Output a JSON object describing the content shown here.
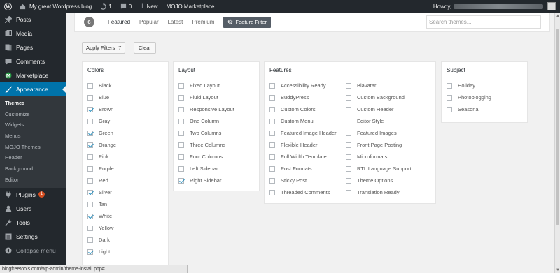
{
  "adminbar": {
    "site_name": "My great Wordpress blog",
    "updates_count": "1",
    "comments_count": "0",
    "new_label": "New",
    "mojo_label": "MOJO Marketplace",
    "howdy": "Howdy,"
  },
  "sidebar": {
    "items": [
      {
        "label": "Posts",
        "icon": "pushpin-icon"
      },
      {
        "label": "Media",
        "icon": "media-icon"
      },
      {
        "label": "Pages",
        "icon": "pages-icon"
      },
      {
        "label": "Comments",
        "icon": "comment-icon"
      },
      {
        "label": "Marketplace",
        "icon": "marketplace-icon"
      },
      {
        "label": "Appearance",
        "icon": "paintbrush-icon"
      }
    ],
    "submenu": [
      "Themes",
      "Customize",
      "Widgets",
      "Menus",
      "MOJO Themes",
      "Header",
      "Background",
      "Editor"
    ],
    "lower_items": [
      {
        "label": "Plugins",
        "icon": "plugin-icon",
        "badge": "1"
      },
      {
        "label": "Users",
        "icon": "users-icon"
      },
      {
        "label": "Tools",
        "icon": "wrench-icon"
      },
      {
        "label": "Settings",
        "icon": "settings-icon"
      },
      {
        "label": "Collapse menu",
        "icon": "collapse-icon"
      }
    ]
  },
  "filterbar": {
    "count": "6",
    "tabs": [
      "Featured",
      "Popular",
      "Latest",
      "Premium"
    ],
    "feature_filter": "Feature Filter",
    "search_placeholder": "Search themes..."
  },
  "actions": {
    "apply_label": "Apply Filters",
    "apply_count": "7",
    "clear_label": "Clear"
  },
  "groups": {
    "colors": {
      "title": "Colors",
      "options": [
        {
          "label": "Black",
          "checked": false
        },
        {
          "label": "Blue",
          "checked": false
        },
        {
          "label": "Brown",
          "checked": true
        },
        {
          "label": "Gray",
          "checked": false
        },
        {
          "label": "Green",
          "checked": true
        },
        {
          "label": "Orange",
          "checked": true
        },
        {
          "label": "Pink",
          "checked": false
        },
        {
          "label": "Purple",
          "checked": false
        },
        {
          "label": "Red",
          "checked": false
        },
        {
          "label": "Silver",
          "checked": true
        },
        {
          "label": "Tan",
          "checked": false
        },
        {
          "label": "White",
          "checked": true
        },
        {
          "label": "Yellow",
          "checked": false
        },
        {
          "label": "Dark",
          "checked": false
        },
        {
          "label": "Light",
          "checked": true
        }
      ]
    },
    "layout": {
      "title": "Layout",
      "options": [
        {
          "label": "Fixed Layout",
          "checked": false
        },
        {
          "label": "Fluid Layout",
          "checked": false
        },
        {
          "label": "Responsive Layout",
          "checked": false
        },
        {
          "label": "One Column",
          "checked": false
        },
        {
          "label": "Two Columns",
          "checked": false
        },
        {
          "label": "Three Columns",
          "checked": false
        },
        {
          "label": "Four Columns",
          "checked": false
        },
        {
          "label": "Left Sidebar",
          "checked": false
        },
        {
          "label": "Right Sidebar",
          "checked": true
        }
      ]
    },
    "features": {
      "title": "Features",
      "col1": [
        {
          "label": "Accessibility Ready",
          "checked": false
        },
        {
          "label": "BuddyPress",
          "checked": false
        },
        {
          "label": "Custom Colors",
          "checked": false
        },
        {
          "label": "Custom Menu",
          "checked": false
        },
        {
          "label": "Featured Image Header",
          "checked": false
        },
        {
          "label": "Flexible Header",
          "checked": false
        },
        {
          "label": "Full Width Template",
          "checked": false
        },
        {
          "label": "Post Formats",
          "checked": false
        },
        {
          "label": "Sticky Post",
          "checked": false
        },
        {
          "label": "Threaded Comments",
          "checked": false
        }
      ],
      "col2": [
        {
          "label": "Blavatar",
          "checked": false
        },
        {
          "label": "Custom Background",
          "checked": false
        },
        {
          "label": "Custom Header",
          "checked": false
        },
        {
          "label": "Editor Style",
          "checked": false
        },
        {
          "label": "Featured Images",
          "checked": false
        },
        {
          "label": "Front Page Posting",
          "checked": false
        },
        {
          "label": "Microformats",
          "checked": false
        },
        {
          "label": "RTL Language Support",
          "checked": false
        },
        {
          "label": "Theme Options",
          "checked": false
        },
        {
          "label": "Translation Ready",
          "checked": false
        }
      ]
    },
    "subject": {
      "title": "Subject",
      "options": [
        {
          "label": "Holiday",
          "checked": false
        },
        {
          "label": "Photoblogging",
          "checked": false
        },
        {
          "label": "Seasonal",
          "checked": false
        }
      ]
    }
  },
  "statusbar": {
    "url": "blogfreetools.com/wp-admin/theme-install.php#"
  },
  "colors": {
    "admin_dark": "#23282d",
    "accent_blue": "#0073aa",
    "badge_orange": "#d54e21",
    "checkmark": "#1e8cbe"
  }
}
